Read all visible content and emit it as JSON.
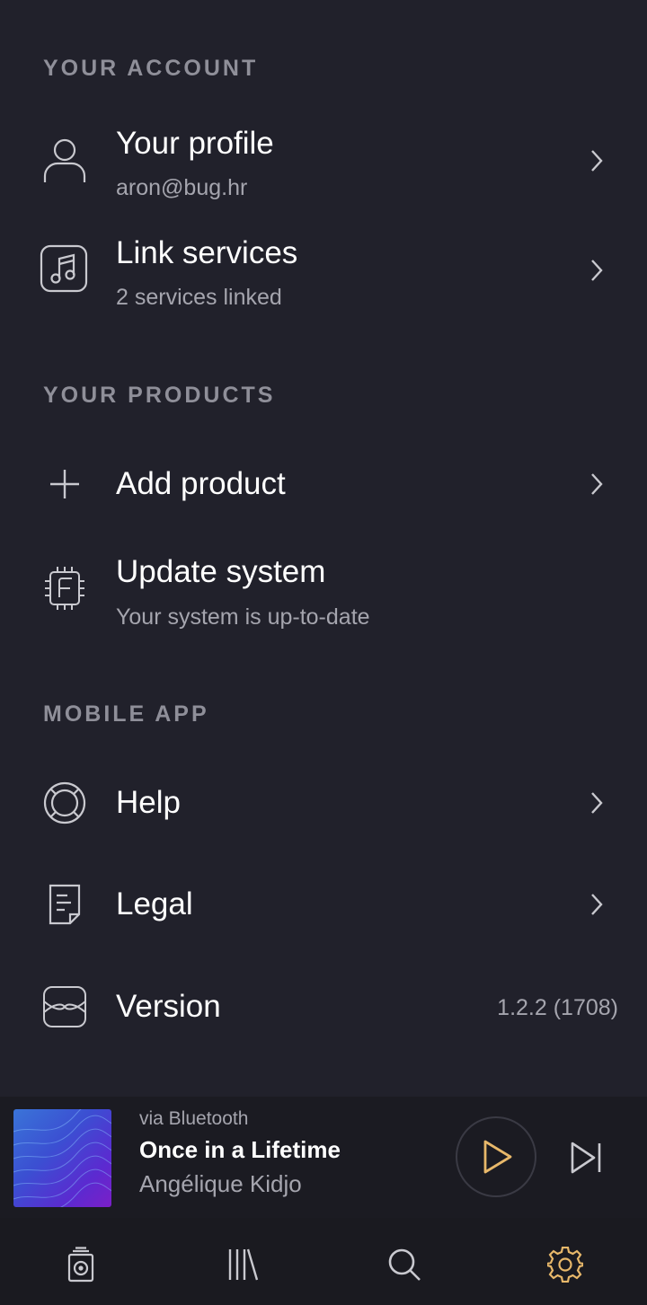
{
  "sections": {
    "account": "YOUR ACCOUNT",
    "products": "YOUR PRODUCTS",
    "mobile_app": "MOBILE APP"
  },
  "account": {
    "profile": {
      "title": "Your profile",
      "subtitle": "aron@bug.hr",
      "icon": "user-icon"
    },
    "link_services": {
      "title": "Link services",
      "subtitle": "2 services linked",
      "icon": "music-note-icon"
    }
  },
  "products": {
    "add_product": {
      "title": "Add product",
      "icon": "plus-icon"
    },
    "update_system": {
      "title": "Update system",
      "subtitle": "Your system is up-to-date",
      "icon": "chip-icon"
    }
  },
  "mobile_app": {
    "help": {
      "title": "Help",
      "icon": "lifebuoy-icon"
    },
    "legal": {
      "title": "Legal",
      "icon": "document-icon"
    },
    "version": {
      "title": "Version",
      "value": "1.2.2 (1708)",
      "icon": "wave-card-icon"
    }
  },
  "player": {
    "source": "via Bluetooth",
    "title": "Once in a Lifetime",
    "artist": "Angélique Kidjo",
    "accent_color": "#e8b86a"
  },
  "bottom_nav": [
    {
      "name": "speaker",
      "icon": "speaker-icon"
    },
    {
      "name": "library",
      "icon": "library-icon"
    },
    {
      "name": "search",
      "icon": "search-icon"
    },
    {
      "name": "settings",
      "icon": "gear-icon",
      "active": true
    }
  ],
  "colors": {
    "background": "#21212b",
    "muted_text": "#a5a5ae",
    "accent": "#e8b86a"
  }
}
